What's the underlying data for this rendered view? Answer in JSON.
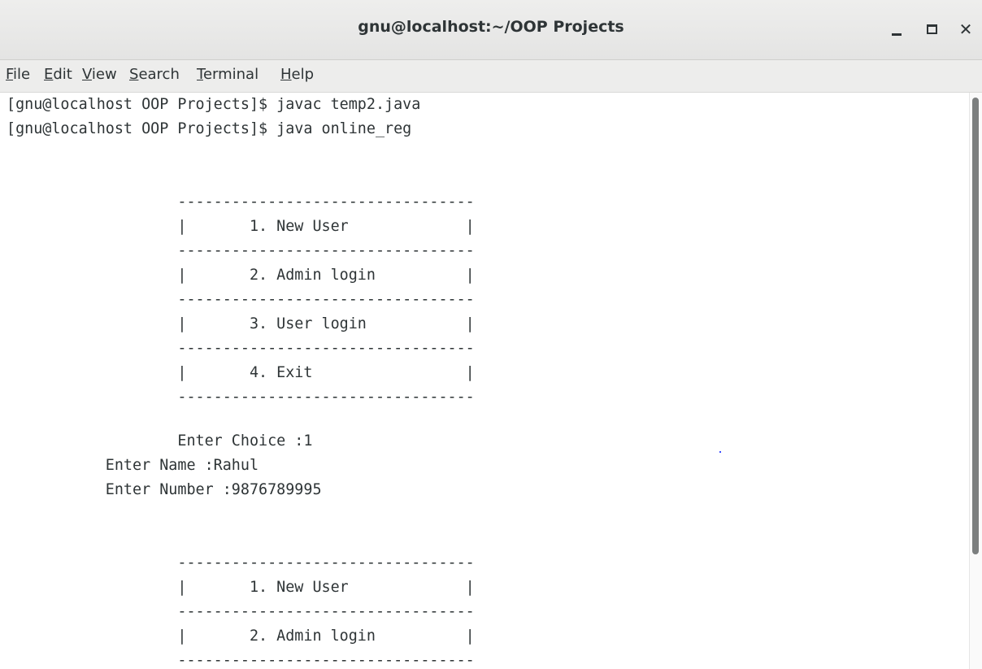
{
  "window": {
    "title": "gnu@localhost:~/OOP Projects"
  },
  "menu": {
    "items": [
      {
        "mnemonic": "F",
        "rest": "ile"
      },
      {
        "mnemonic": "E",
        "rest": "dit"
      },
      {
        "mnemonic": "V",
        "rest": "iew"
      },
      {
        "mnemonic": "S",
        "rest": "earch"
      },
      {
        "mnemonic": "T",
        "rest": "erminal"
      },
      {
        "mnemonic": "H",
        "rest": "elp"
      }
    ]
  },
  "terminal": {
    "lines": [
      "[gnu@localhost OOP Projects]$ javac temp2.java",
      "[gnu@localhost OOP Projects]$ java online_reg",
      "",
      "",
      "                   ---------------------------------",
      "                   |       1. New User             |",
      "                   ---------------------------------",
      "                   |       2. Admin login          |",
      "                   ---------------------------------",
      "                   |       3. User login           |",
      "                   ---------------------------------",
      "                   |       4. Exit                 |",
      "                   ---------------------------------",
      "",
      "                   Enter Choice :1",
      "           Enter Name :Rahul",
      "           Enter Number :9876789995",
      "",
      "",
      "                   ---------------------------------",
      "                   |       1. New User             |",
      "                   ---------------------------------",
      "                   |       2. Admin login          |",
      "                   ---------------------------------"
    ]
  },
  "colors": {
    "text": "#2e3436",
    "background": "#ffffff",
    "titlebar": "#e8e8e7",
    "scrollbar_thumb": "#7c7f7f"
  },
  "icons": [
    "minimize-icon",
    "maximize-icon",
    "close-icon"
  ]
}
